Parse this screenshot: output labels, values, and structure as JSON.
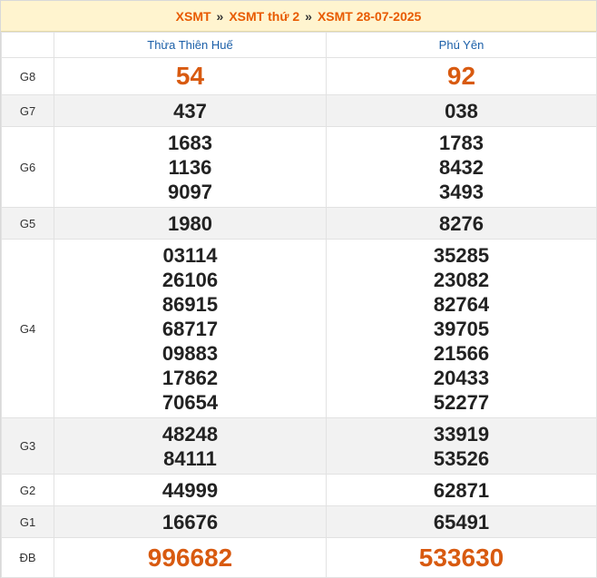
{
  "breadcrumb": {
    "item1": "XSMT",
    "sep": "»",
    "item2": "XSMT thứ 2",
    "item3": "XSMT 28-07-2025"
  },
  "provinces": [
    "Thừa Thiên Huế",
    "Phú Yên"
  ],
  "prizes": [
    {
      "label": "G8",
      "p1": [
        "54"
      ],
      "p2": [
        "92"
      ]
    },
    {
      "label": "G7",
      "p1": [
        "437"
      ],
      "p2": [
        "038"
      ]
    },
    {
      "label": "G6",
      "p1": [
        "1683",
        "1136",
        "9097"
      ],
      "p2": [
        "1783",
        "8432",
        "3493"
      ]
    },
    {
      "label": "G5",
      "p1": [
        "1980"
      ],
      "p2": [
        "8276"
      ]
    },
    {
      "label": "G4",
      "p1": [
        "03114",
        "26106",
        "86915",
        "68717",
        "09883",
        "17862",
        "70654"
      ],
      "p2": [
        "35285",
        "23082",
        "82764",
        "39705",
        "21566",
        "20433",
        "52277"
      ]
    },
    {
      "label": "G3",
      "p1": [
        "48248",
        "84111"
      ],
      "p2": [
        "33919",
        "53526"
      ]
    },
    {
      "label": "G2",
      "p1": [
        "44999"
      ],
      "p2": [
        "62871"
      ]
    },
    {
      "label": "G1",
      "p1": [
        "16676"
      ],
      "p2": [
        "65491"
      ]
    },
    {
      "label": "ĐB",
      "p1": [
        "996682"
      ],
      "p2": [
        "533630"
      ]
    }
  ],
  "colors": {
    "accent": "#e85a00",
    "highlight_number": "#d85a10",
    "header_text": "#1b5fa8",
    "title_bg": "#fff4cf"
  }
}
